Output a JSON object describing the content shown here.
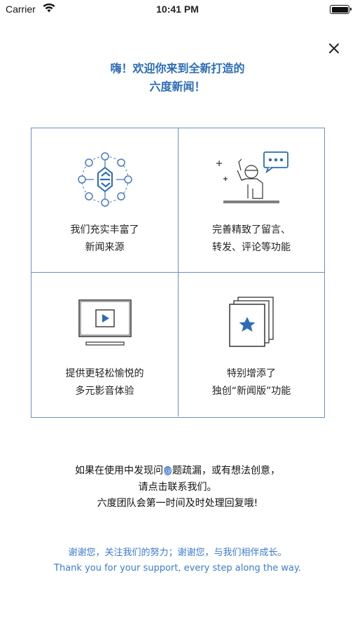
{
  "status_bar": {
    "carrier": "Carrier",
    "time": "10:41 PM"
  },
  "header": {
    "title_line1": "嗨！欢迎你来到全新打造的",
    "title_line2": "六度新闻！"
  },
  "features": [
    {
      "line1": "我们充实丰富了",
      "line2": "新闻来源",
      "icon": "news-network-icon"
    },
    {
      "line1": "完善精致了留言、",
      "line2": "转发、评论等功能",
      "icon": "speaker-chat-icon"
    },
    {
      "line1": "提供更轻松愉悦的",
      "line2": "多元影音体验",
      "icon": "video-play-icon"
    },
    {
      "line1": "特别增添了",
      "line2": "独创“新闻版”功能",
      "icon": "star-cards-icon"
    }
  ],
  "feedback": {
    "line1_part1": "如果在使用中发现问",
    "line1_part2": "题疏漏，或有想法创意，",
    "line2_part1": "请点击",
    "line2_part2": "联系我们。",
    "line3": "六度团队会第一时间及时处理回复哦!",
    "contact_icon": "contact-icon"
  },
  "thanks": {
    "zh": "谢谢您，关注我们的努力；谢谢您，与我们相伴成长。",
    "en": "Thank you for your support, every step along the way."
  },
  "colors": {
    "accent": "#2b6cb8",
    "grid_border": "#6b8fcc",
    "link_blue": "#3b7bd4"
  }
}
